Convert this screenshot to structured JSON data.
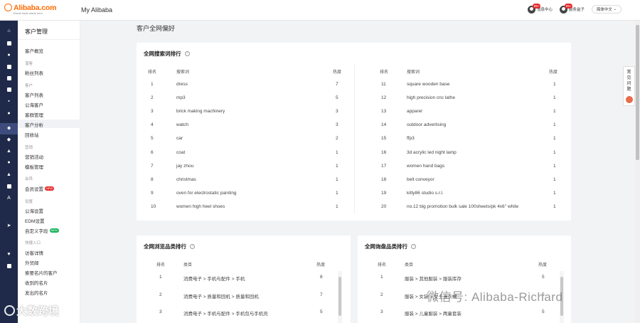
{
  "header": {
    "logo_text": "Alibaba.com",
    "logo_tagline": "Global trade starts here.",
    "title": "My Alibaba",
    "msg_center_label": "消息中心",
    "msg_center_badge": "99+",
    "service_label": "服务盒子",
    "service_badge": "99+",
    "language": "简体中文"
  },
  "subnav": {
    "title": "客户管理",
    "items": [
      {
        "label": "客户概览",
        "group": false
      },
      {
        "label": "潜客",
        "group": true
      },
      {
        "label": "粉丝列表",
        "group": false
      },
      {
        "label": "客户",
        "group": true
      },
      {
        "label": "客户列表",
        "group": false
      },
      {
        "label": "公海客户",
        "group": false
      },
      {
        "label": "客群管理",
        "group": false
      },
      {
        "label": "客户分析",
        "group": false,
        "active": true
      },
      {
        "label": "回收站",
        "group": false
      },
      {
        "label": "营销",
        "group": true
      },
      {
        "label": "营销活动",
        "group": false
      },
      {
        "label": "模板管理",
        "group": false
      },
      {
        "label": "会员",
        "group": true
      },
      {
        "label": "会员设置",
        "group": false,
        "badge": "NEW"
      },
      {
        "label": "设置",
        "group": true
      },
      {
        "label": "公海设置",
        "group": false
      },
      {
        "label": "EDM设置",
        "group": false
      },
      {
        "label": "自定义字段",
        "group": false,
        "badge": "NEW",
        "badge_color": "green"
      },
      {
        "label": "快捷入口",
        "group": true
      },
      {
        "label": "访客详情",
        "group": false
      },
      {
        "label": "外贸邮",
        "group": false
      },
      {
        "label": "索要名片的客户",
        "group": false
      },
      {
        "label": "收到的名片",
        "group": false
      },
      {
        "label": "发出的名片",
        "group": false
      }
    ]
  },
  "page_title": "客户全网偏好",
  "search_card": {
    "title": "全网搜索词排行",
    "help_icon": "?",
    "headers": {
      "rank": "排名",
      "keyword": "搜索词",
      "heat": "热度"
    },
    "left_rows": [
      {
        "rank": "1",
        "keyword": "dress",
        "heat": "7"
      },
      {
        "rank": "2",
        "keyword": "mp3",
        "heat": "5"
      },
      {
        "rank": "3",
        "keyword": "brick making machinery",
        "heat": "3"
      },
      {
        "rank": "4",
        "keyword": "watch",
        "heat": "3"
      },
      {
        "rank": "5",
        "keyword": "car",
        "heat": "2"
      },
      {
        "rank": "6",
        "keyword": "coat",
        "heat": "1"
      },
      {
        "rank": "7",
        "keyword": "jay zhou",
        "heat": "1"
      },
      {
        "rank": "8",
        "keyword": "christmas",
        "heat": "1"
      },
      {
        "rank": "9",
        "keyword": "oven for electrostatic painting",
        "heat": "1"
      },
      {
        "rank": "10",
        "keyword": "women high heel shoes",
        "heat": "1"
      }
    ],
    "right_rows": [
      {
        "rank": "11",
        "keyword": "square wooden base",
        "heat": "1"
      },
      {
        "rank": "12",
        "keyword": "high precision cnc lathe",
        "heat": "1"
      },
      {
        "rank": "13",
        "keyword": "apparel",
        "heat": "1"
      },
      {
        "rank": "14",
        "keyword": "outdoor advertising",
        "heat": "1"
      },
      {
        "rank": "15",
        "keyword": "ffp3",
        "heat": "1"
      },
      {
        "rank": "16",
        "keyword": "3d acrylic led night lamp",
        "heat": "1"
      },
      {
        "rank": "17",
        "keyword": "women hand bags",
        "heat": "1"
      },
      {
        "rank": "18",
        "keyword": "belt conveyor",
        "heat": "1"
      },
      {
        "rank": "19",
        "keyword": "kitty86 studio s.r.l.",
        "heat": "1"
      },
      {
        "rank": "20",
        "keyword": "no.12 big promotion bulk sale 100sheets/pk 4x6'' white",
        "heat": "1"
      }
    ]
  },
  "browse_card": {
    "title": "全网浏览品类排行",
    "help_icon": "?",
    "headers": {
      "rank": "排名",
      "category": "类目",
      "heat": "热度"
    },
    "rows": [
      {
        "rank": "1",
        "category": "消费电子 > 手机与配件 > 手机",
        "heat": "8"
      },
      {
        "rank": "2",
        "category": "消费电子 > 质量和回机 > 质量和回机",
        "heat": "7"
      },
      {
        "rank": "3",
        "category": "消费电子 > 手机与配件 > 手机包与手机壳",
        "heat": "5"
      }
    ]
  },
  "inquiry_card": {
    "title": "全网询盘品类排行",
    "help_icon": "?",
    "headers": {
      "rank": "排名",
      "category": "类目",
      "heat": "热度"
    },
    "rows": [
      {
        "rank": "1",
        "category": "服装 > 其他服装 > 服装库存",
        "heat": "5"
      },
      {
        "rank": "2",
        "category": "服装 > 女装 > 女士连衣裙",
        "heat": "5"
      },
      {
        "rank": "3",
        "category": "服装 > 儿童服装 > 两童套装",
        "heat": "5"
      }
    ]
  },
  "faq": {
    "label": "常见问题"
  },
  "watermark": {
    "right": "微信号: Alibaba-Richard",
    "left": "大数跨境"
  },
  "colors": {
    "brand": "#ff6a00",
    "rail": "#1f2a4a",
    "badge": "#e62a2a"
  }
}
